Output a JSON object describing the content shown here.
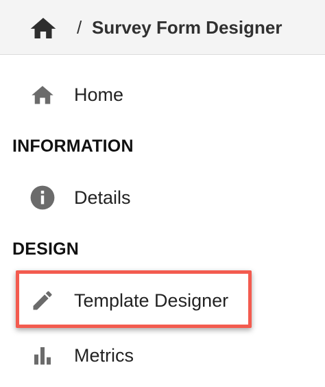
{
  "header": {
    "separator": "/",
    "title": "Survey Form Designer",
    "home_icon": "home-icon"
  },
  "nav": {
    "home": {
      "label": "Home",
      "icon": "home-icon"
    },
    "sections": [
      {
        "header": "INFORMATION",
        "items": [
          {
            "label": "Details",
            "icon": "info-icon"
          }
        ]
      },
      {
        "header": "DESIGN",
        "items": [
          {
            "label": "Template Designer",
            "icon": "pencil-icon",
            "highlighted": true
          },
          {
            "label": "Metrics",
            "icon": "bar-chart-icon"
          }
        ]
      }
    ]
  },
  "colors": {
    "highlight": "#f35b4f",
    "icon": "#6b6b6b",
    "header_bg": "#f4f4f4"
  }
}
